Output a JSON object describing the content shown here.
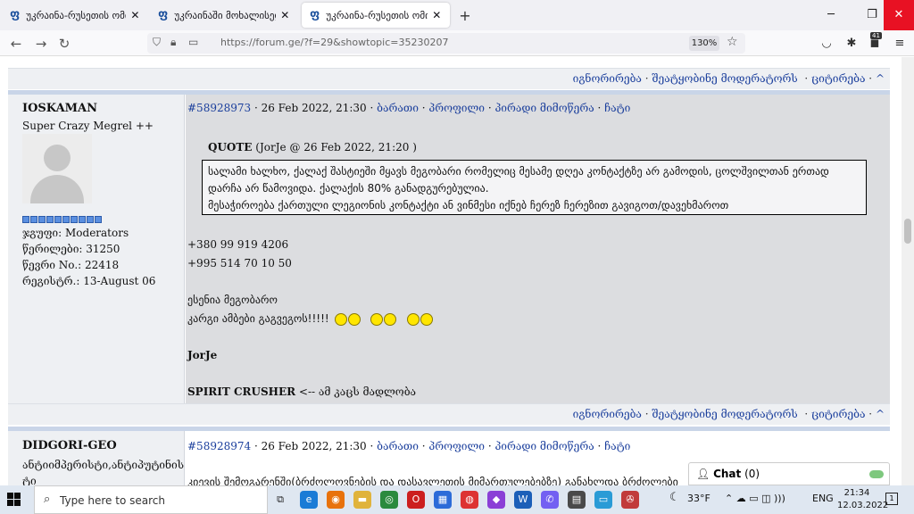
{
  "browser": {
    "tabs": [
      {
        "title": "უკრაინა-რუსეთის ომი!! მ ხ",
        "active": false
      },
      {
        "title": "უკრაინაში მოხალისედ წას",
        "active": false
      },
      {
        "title": "უკრაინა-რუსეთის ომი!! მ ხ",
        "active": true
      }
    ],
    "url": "https://forum.ge/?f=29&showtopic=35230207",
    "zoom": "130%",
    "extension_badge": "41"
  },
  "actions": {
    "ignore": "იგნორირება",
    "report": "შეატყობინე მოდერატორს",
    "quote": "ციტირება",
    "dot": "·",
    "top": "^"
  },
  "post1": {
    "username": "IOSKAMAN",
    "user_title": "Super Crazy Megrel ++",
    "group": "ჯგუფი: Moderators",
    "posts": "წერილები: 31250",
    "member_no": "წევრი No.: 22418",
    "registered": "რეგისტრ.: 13-August 06",
    "post_id": "#58928973",
    "date": "26 Feb 2022, 21:30",
    "links": [
      "ბარათი",
      "პროფილი",
      "პირადი მიმოწერა",
      "ჩატი"
    ],
    "quote_label": "QUOTE",
    "quote_source": "(JorJe @ 26 Feb 2022, 21:20 )",
    "quote_lines": [
      "სალამი ხალხო, ქალაქ შასტიეში მყავს მეგობარი რომელიც მესამე დღეა კონტაქტზე არ გამოდის, ცოლშვილთან ერთად",
      "დარჩა არ წამოვიდა. ქალაქის 80% განადგურებულია.",
      "მესაჭიროება ქართული ლეგიონის კონტაქტი ან ვინმესი იქნებ ჩერეზ ჩერეზით გავიგოთ/დავეხმაროთ"
    ],
    "phone1": "+380 99 919 4206",
    "phone2": "+995 514 70 10 50",
    "line_friend": "ესენია მეგობარო",
    "line_news": "კარგი ამბები გაგვეგოს!!!!!",
    "signature": "JorJe",
    "spirit_bold": "SPIRIT CRUSHER",
    "spirit_rest": " <-- ამ კაცს მადლობა"
  },
  "post2": {
    "username": "DIDGORI-GEO",
    "user_title_line1": "ანტიიმპერისტი,ანტიპუტინის",
    "user_title_line2": "ტი",
    "post_id": "#58928974",
    "date": "26 Feb 2022, 21:30",
    "links": [
      "ბარათი",
      "პროფილი",
      "პირადი მიმოწერა",
      "ჩატი"
    ],
    "body_start": "კიევის შემოგარენში(ბრძოლოვნების და დასავლეთის მიმართულებებზე) განახლდა ბრძოლები"
  },
  "chat": {
    "label": "Chat",
    "count": "(0)"
  },
  "taskbar": {
    "search_placeholder": "Type here to search",
    "weather": "33°F",
    "language": "ENG",
    "time": "21:34",
    "date": "12.03.2022",
    "notification_count": "1"
  }
}
